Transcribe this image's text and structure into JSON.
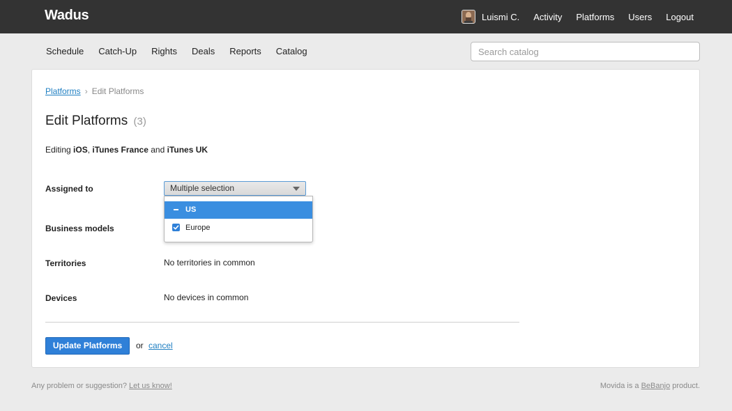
{
  "header": {
    "brand": "Wadus",
    "user_name": "Luismi C.",
    "nav": [
      "Activity",
      "Platforms",
      "Users",
      "Logout"
    ]
  },
  "subnav": {
    "items": [
      "Schedule",
      "Catch-Up",
      "Rights",
      "Deals",
      "Reports",
      "Catalog"
    ],
    "search_placeholder": "Search catalog"
  },
  "breadcrumb": {
    "parent": "Platforms",
    "separator": "›",
    "current": "Edit Platforms"
  },
  "page": {
    "title": "Edit Platforms",
    "count": "(3)",
    "editing_prefix": "Editing",
    "editing_item_1": "iOS",
    "editing_comma": ",",
    "editing_item_2": "iTunes France",
    "editing_and": "and",
    "editing_item_3": "iTunes UK"
  },
  "form": {
    "assigned_to_label": "Assigned to",
    "assigned_to_value": "Multiple selection",
    "dropdown_options": [
      {
        "label": "US",
        "state": "indeterminate"
      },
      {
        "label": "Europe",
        "state": "checked"
      }
    ],
    "business_models_label": "Business models",
    "territories_label": "Territories",
    "territories_value": "No territories in common",
    "devices_label": "Devices",
    "devices_value": "No devices in common",
    "submit_label": "Update Platforms",
    "or_text": "or",
    "cancel_label": "cancel"
  },
  "footer": {
    "left_text": "Any problem or suggestion?",
    "left_link": "Let us know!",
    "right_prefix": "Movida is a",
    "right_link": "BeBanjo",
    "right_suffix": "product."
  },
  "colors": {
    "topbar": "#333333",
    "accent": "#2f80d8",
    "link": "#1f7fc2",
    "background": "#ebebeb"
  }
}
